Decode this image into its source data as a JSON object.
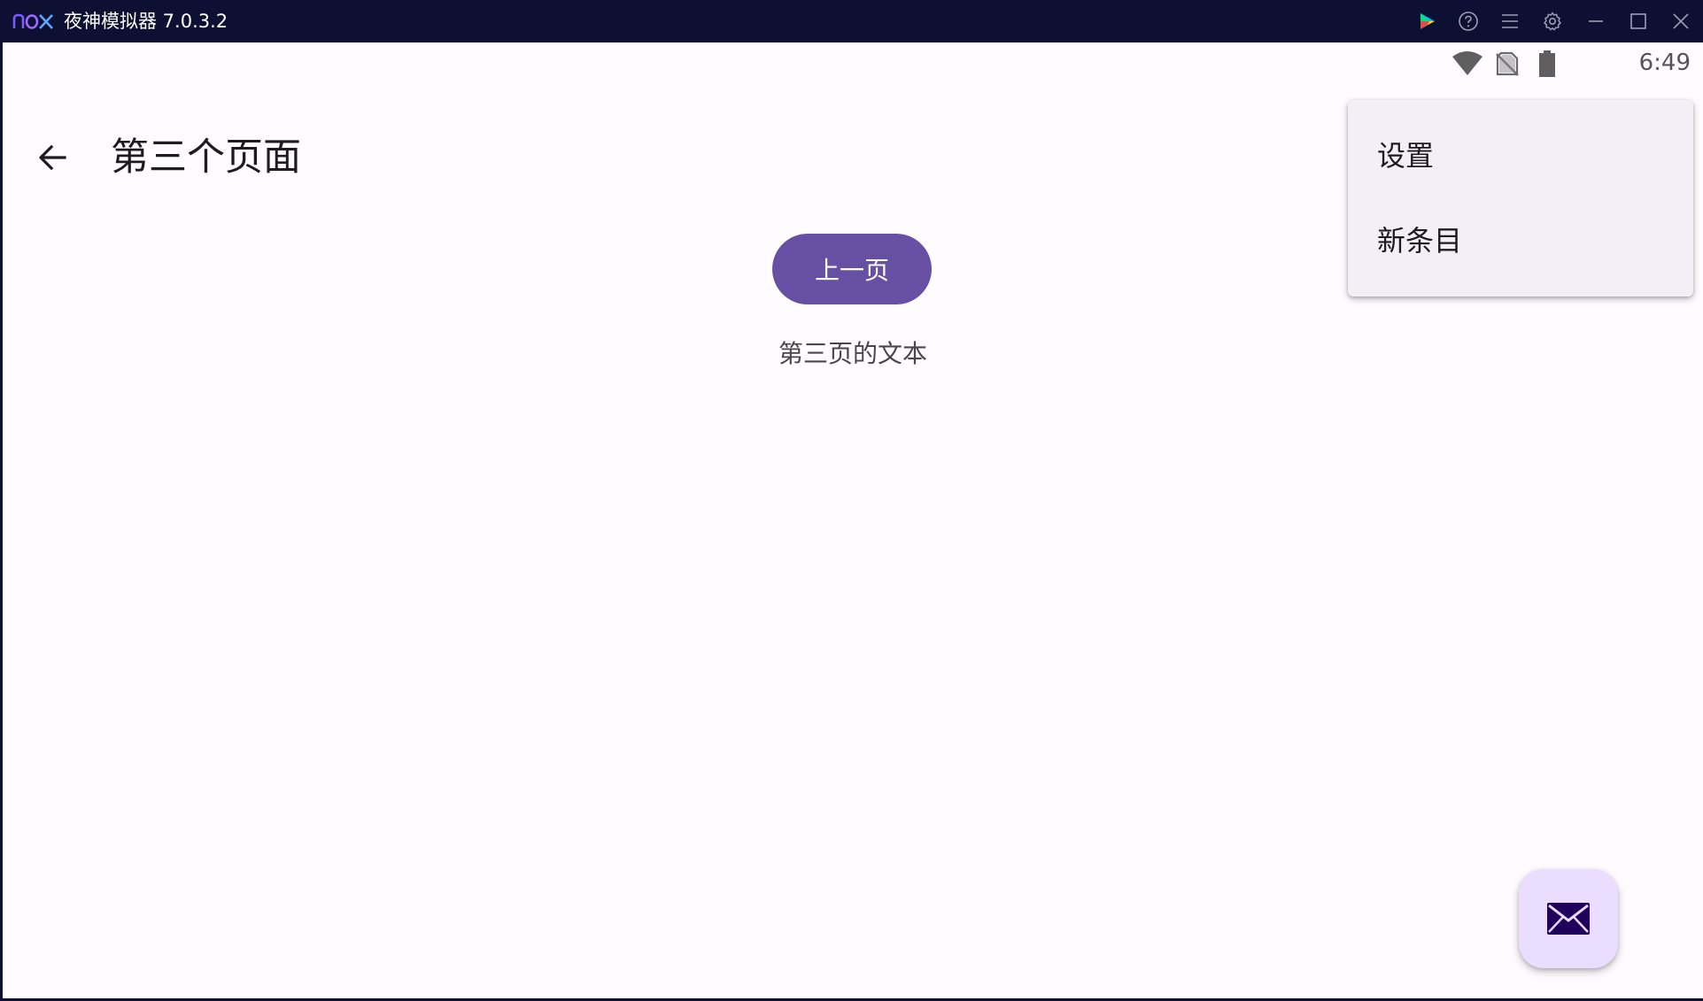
{
  "emulator": {
    "logo_text": "nox",
    "title": "夜神模拟器 7.0.3.2",
    "toolbar_icons": [
      "play-store-icon",
      "help-icon",
      "menu-icon",
      "settings-icon",
      "minimize-icon",
      "maximize-icon",
      "close-icon"
    ]
  },
  "status_bar": {
    "time": "6:49",
    "icons": [
      "wifi-icon",
      "no-sim-icon",
      "battery-icon"
    ]
  },
  "app_bar": {
    "title": "第三个页面",
    "back_icon": "arrow-back-icon"
  },
  "content": {
    "prev_button_label": "上一页",
    "page_text": "第三页的文本"
  },
  "overflow_menu": {
    "items": [
      {
        "label": "设置"
      },
      {
        "label": "新条目"
      }
    ]
  },
  "fab": {
    "icon": "mail-icon"
  },
  "colors": {
    "titlebar_bg": "#0d0f33",
    "screen_bg": "#fffbfe",
    "primary": "#6750a4",
    "menu_bg": "#f3eff7",
    "fab_bg": "#eaddff",
    "fab_icon": "#21005d"
  }
}
